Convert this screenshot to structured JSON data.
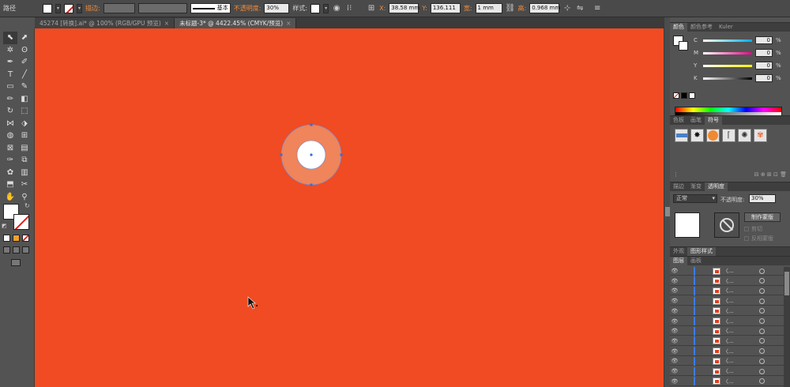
{
  "control_bar": {
    "selection_type": "路径",
    "stroke_label": "描边:",
    "stroke_profile": "基本",
    "opacity_label": "不透明度:",
    "opacity_value": "30%",
    "style_label": "样式:",
    "x_label": "X:",
    "x_value": "38.58 mm",
    "y_label": "Y:",
    "y_value": "136.111",
    "w_label": "宽:",
    "w_value": "1 mm",
    "h_label": "高:",
    "h_value": "0.968 mm"
  },
  "tabs": [
    {
      "label": "45274 [转换].ai* @ 100% (RGB/GPU 预览)",
      "close": "×"
    },
    {
      "label": "未标题-3* @ 4422.45% (CMYK/预览)",
      "close": "×"
    }
  ],
  "tools": [
    "selection-tool",
    "direct-selection-tool",
    "magic-wand-tool",
    "lasso-tool",
    "pen-tool",
    "curvature-tool",
    "type-tool",
    "line-tool",
    "rectangle-tool",
    "paintbrush-tool",
    "pencil-tool",
    "eraser-tool",
    "rotate-tool",
    "scale-tool",
    "width-tool",
    "free-transform-tool",
    "shape-builder-tool",
    "perspective-tool",
    "mesh-tool",
    "gradient-tool",
    "eyedropper-tool",
    "blend-tool",
    "symbol-sprayer-tool",
    "column-graph-tool",
    "artboard-tool",
    "slice-tool",
    "hand-tool",
    "zoom-tool"
  ],
  "tool_glyphs": [
    "⬉",
    "⬈",
    "✲",
    "ʘ",
    "✒",
    "✐",
    "T",
    "╱",
    "▭",
    "✎",
    "✏",
    "◧",
    "↻",
    "⬚",
    "⋈",
    "⬗",
    "◍",
    "⊞",
    "⊠",
    "▤",
    "✑",
    "⧉",
    "✿",
    "▥",
    "⬒",
    "✂",
    "✋",
    "⚲"
  ],
  "colors": {
    "canvas_bg": "#f04b22",
    "artwork_outer": "#f0845a",
    "artwork_inner": "#ffffff",
    "path_outline": "#6c8ad8",
    "selection_anchor": "#3a6bd8"
  },
  "color_panel": {
    "tabs": [
      "颜色",
      "颜色参考",
      "Kuler"
    ],
    "channels": [
      {
        "name": "C",
        "value": "0",
        "unit": "%"
      },
      {
        "name": "M",
        "value": "0",
        "unit": "%"
      },
      {
        "name": "Y",
        "value": "0",
        "unit": "%"
      },
      {
        "name": "K",
        "value": "0",
        "unit": "%"
      }
    ]
  },
  "swatch_panel": {
    "tabs": [
      "色板",
      "画笔",
      "符号"
    ]
  },
  "transparency_panel": {
    "tabs": [
      "描边",
      "渐变",
      "透明度"
    ],
    "blend_mode": "正常",
    "opacity_label": "不透明度:",
    "opacity_value": "30%",
    "make_mask_button": "制作蒙版",
    "clip_label": "剪切",
    "invert_mask_label": "反相蒙版"
  },
  "appearance_panel": {
    "tabs": [
      "外观",
      "图形样式"
    ]
  },
  "layers_panel": {
    "tabs": [
      "图层",
      "画板"
    ],
    "row_label": "〈...",
    "row_count": 12
  }
}
